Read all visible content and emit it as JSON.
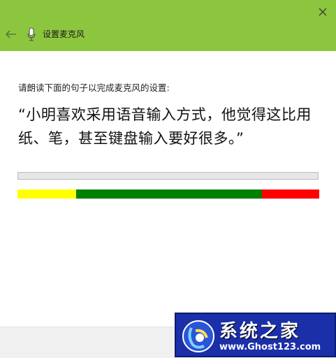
{
  "window": {
    "title": "设置麦克风",
    "accent_color": "#8cc63f",
    "close_icon": "close-icon",
    "back_icon": "back-arrow-icon",
    "title_icon": "microphone-icon"
  },
  "content": {
    "instruction": "请朗读下面的句子以完成麦克风的设置:",
    "sentence": "“小明喜欢采用语音输入方式，他觉得这比用纸、笔，甚至键盘输入要好很多。”"
  },
  "progress": {
    "value_fraction": 0.0,
    "track_color": "#e6e6e6"
  },
  "level_meter": {
    "segments": [
      {
        "name": "low",
        "color": "#ffff00",
        "fraction": 0.195
      },
      {
        "name": "good",
        "color": "#008000",
        "fraction": 0.615
      },
      {
        "name": "high",
        "color": "#ff0000",
        "fraction": 0.19
      }
    ]
  },
  "watermark": {
    "title": "系统之家",
    "url": "www.Ghost123.com"
  }
}
